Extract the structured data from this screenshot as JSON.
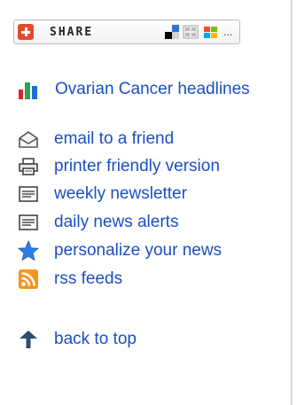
{
  "share": {
    "label": "SHARE",
    "ellipsis": "..."
  },
  "links": [
    {
      "label": "Ovarian Cancer headlines",
      "icon": "bar-chart-icon"
    },
    {
      "label": "email to a friend",
      "icon": "envelope-icon"
    },
    {
      "label": "printer friendly version",
      "icon": "printer-icon"
    },
    {
      "label": "weekly newsletter",
      "icon": "newsletter-icon"
    },
    {
      "label": "daily news alerts",
      "icon": "news-alert-icon"
    },
    {
      "label": "personalize your news",
      "icon": "star-icon"
    },
    {
      "label": "rss feeds",
      "icon": "rss-icon"
    }
  ],
  "back_to_top": {
    "label": "back to top",
    "icon": "up-arrow-icon"
  },
  "colors": {
    "link": "#1a4fc4",
    "star": "#2b7fe0",
    "rss": "#f7941d",
    "share_plus": "#e54a2a"
  }
}
